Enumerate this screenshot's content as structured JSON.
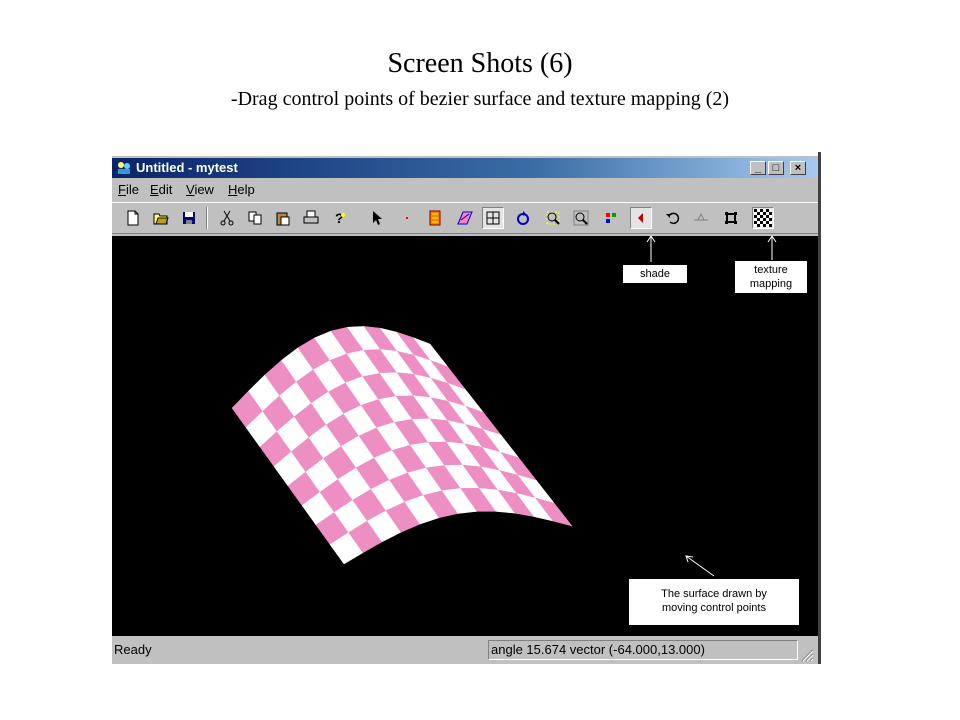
{
  "slide": {
    "title": "Screen Shots (6)",
    "subtitle": "-Drag control points of bezier surface and texture mapping (2)"
  },
  "window": {
    "title": "Untitled - mytest",
    "controls": {
      "minimize": "_",
      "maximize": "□",
      "close": "×"
    }
  },
  "menu": {
    "file": {
      "accel": "F",
      "rest": "ile"
    },
    "edit": {
      "accel": "E",
      "rest": "dit"
    },
    "view": {
      "accel": "V",
      "rest": "iew"
    },
    "help": {
      "accel": "H",
      "rest": "elp"
    }
  },
  "toolbar": {
    "buttons": [
      "new-file",
      "open-file",
      "save",
      "cut",
      "copy",
      "paste",
      "print",
      "help",
      "select-arrow",
      "point",
      "bezier-surface",
      "curve",
      "grid",
      "rotate",
      "zoom-in",
      "zoom-out",
      "color-points",
      "shade",
      "undo",
      "flat",
      "control-points",
      "texture-mapping"
    ],
    "pressed": [
      "grid",
      "shade",
      "texture-mapping"
    ]
  },
  "callouts": {
    "shade": "shade",
    "texture_line1": "texture",
    "texture_line2": "mapping",
    "surface_line1": "The  surface drawn by",
    "surface_line2": "moving control points"
  },
  "surface": {
    "color_a": "#ee8fc3",
    "color_b": "#ffffff"
  },
  "status": {
    "ready": "Ready",
    "readout": "angle 15.674 vector (-64.000,13.000)"
  }
}
